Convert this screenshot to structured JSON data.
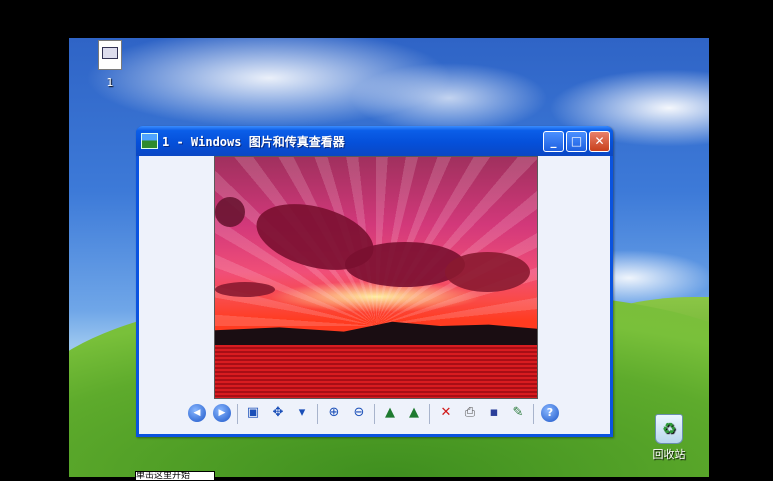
{
  "desktop": {
    "icons": [
      {
        "label": "1"
      },
      {
        "label": "回收站"
      }
    ]
  },
  "window": {
    "title": "1 - Windows 图片和传真查看器",
    "buttons": {
      "minimize": "_",
      "maximize": "□",
      "close": "✕"
    }
  },
  "toolbar": {
    "items": [
      {
        "name": "previous-image",
        "glyph": "◀"
      },
      {
        "name": "next-image",
        "glyph": "▶"
      },
      {
        "name": "best-fit",
        "glyph": "▣"
      },
      {
        "name": "actual-size",
        "glyph": "✥"
      },
      {
        "name": "slideshow",
        "glyph": "▾"
      },
      {
        "name": "zoom-in",
        "glyph": "⊕"
      },
      {
        "name": "zoom-out",
        "glyph": "⊖"
      },
      {
        "name": "rotate-clockwise",
        "glyph": "▲"
      },
      {
        "name": "rotate-counterclockwise",
        "glyph": "▲"
      },
      {
        "name": "delete",
        "glyph": "✕"
      },
      {
        "name": "print",
        "glyph": "⎙"
      },
      {
        "name": "save",
        "glyph": "▪"
      },
      {
        "name": "edit",
        "glyph": "✎"
      },
      {
        "name": "help",
        "glyph": "?"
      }
    ]
  },
  "taskbar": {
    "partial_label": "单击这里开始"
  },
  "colors": {
    "titlebar": "#0550da",
    "client_bg": "#eef2fb",
    "close_button": "#c8401c"
  }
}
